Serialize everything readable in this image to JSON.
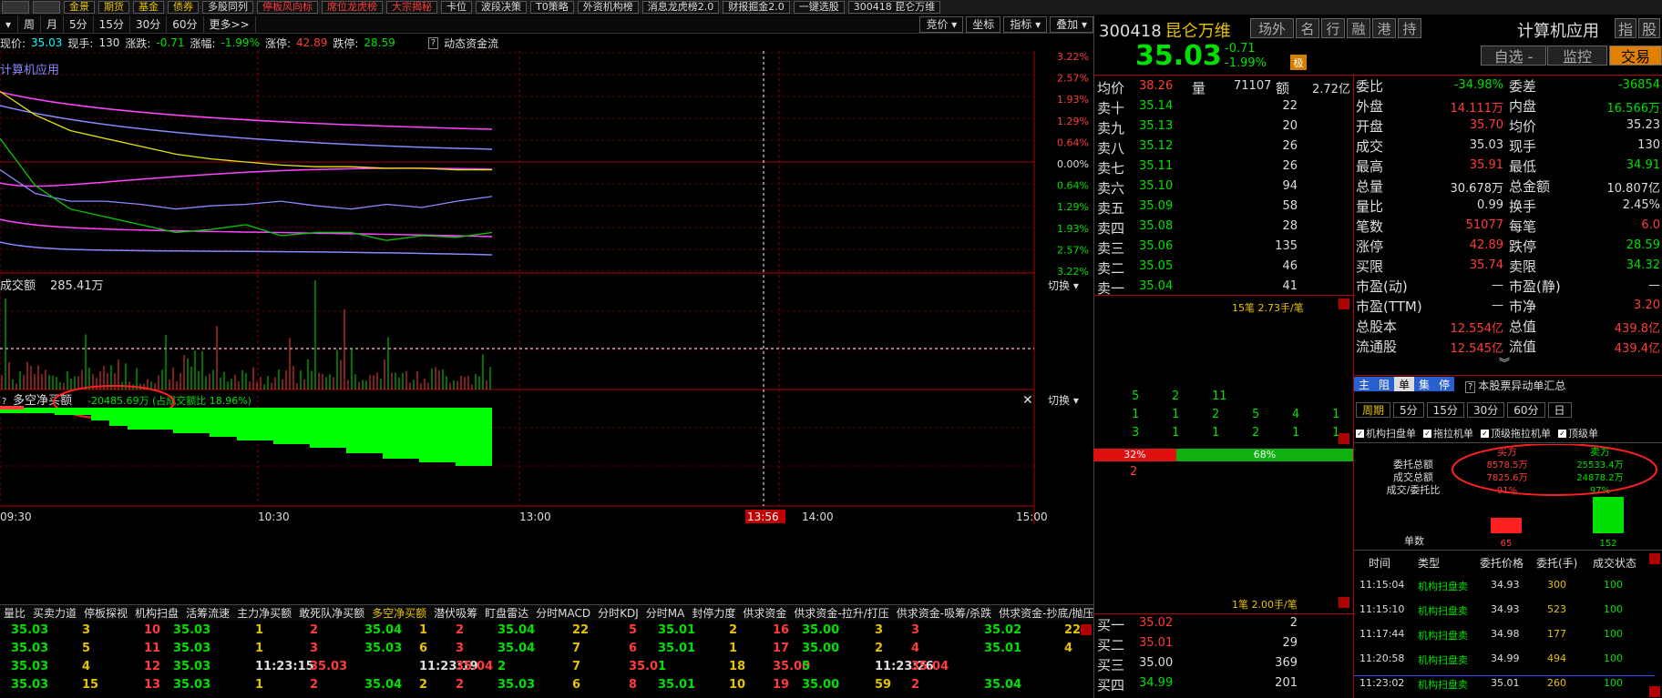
{
  "topbar": {
    "left_items": [
      "金景",
      "期货",
      "基金",
      "债券",
      "多股同列",
      "停板风向标",
      "席位龙虎榜",
      "大宗揭秘",
      "卡位",
      "波段决策",
      "T0策略",
      "外资机构榜",
      "消息龙虎榜2.0",
      "财报掘金2.0",
      "一键选股",
      "300418 昆仑万维"
    ],
    "red_indices": [
      5,
      6,
      7
    ]
  },
  "period_toolbar": {
    "periods": [
      "周",
      "月",
      "5分",
      "15分",
      "30分",
      "60分",
      "更多>>"
    ],
    "right_buttons": [
      "竞价 ▾",
      "坐标",
      "指标 ▾",
      "叠加 ▾"
    ]
  },
  "quote": {
    "price_label": "现价:",
    "price": "35.03",
    "vol_label": "现手:",
    "vol": "130",
    "chg_label": "涨跌:",
    "chg": "-0.71",
    "pct_label": "涨幅:",
    "pct": "-1.99%",
    "up_limit_label": "涨停:",
    "up_limit": "42.89",
    "down_limit_label": "跌停:",
    "down_limit": "28.59",
    "dynamic_flow": "动态资金流",
    "sector": "计算机应用"
  },
  "chart_data": {
    "type": "line",
    "title": "",
    "x_ticks": [
      "09:30",
      "10:30",
      "13:00",
      "13:56",
      "14:00",
      "15:00"
    ],
    "pct_ticks_right": [
      "3.22%",
      "2.57%",
      "1.93%",
      "1.29%",
      "0.64%",
      "0.00%",
      "0.64%",
      "1.29%",
      "1.93%",
      "2.57%",
      "3.22%"
    ],
    "volume_title": "成交额",
    "volume_value": "285.41万",
    "net_title": "多空净买额",
    "net_value": "-20485.69万 (占成交额比 18.96%)",
    "switch_label": "切换 ▾",
    "series": [
      {
        "name": "price",
        "color": "#8888ff",
        "values": [
          35.2,
          35.05,
          35.0,
          35.0,
          34.98,
          34.95,
          34.97,
          34.98,
          35.0,
          34.97,
          34.95,
          34.98,
          34.96,
          35.0,
          35.03
        ]
      },
      {
        "name": "avg",
        "color": "#e6e600",
        "values": [
          35.7,
          35.55,
          35.45,
          35.4,
          35.35,
          35.3,
          35.27,
          35.25,
          35.23,
          35.22,
          35.22,
          35.21,
          35.21,
          35.2,
          35.2
        ]
      },
      {
        "name": "sector",
        "color": "#00cc00",
        "values": [
          35.4,
          35.1,
          34.95,
          34.9,
          34.85,
          34.8,
          34.82,
          34.85,
          34.78,
          34.8,
          34.8,
          34.75,
          34.78,
          34.77,
          34.8
        ]
      }
    ]
  },
  "stock": {
    "code": "300418",
    "name": "昆仑万维",
    "price": "35.03",
    "chg": "-0.71",
    "pct": "-1.99%",
    "tags": [
      "场外",
      "名",
      "行",
      "融",
      "港",
      "持"
    ],
    "sector": "计算机应用",
    "sector_tag": "指",
    "sector_tag2": "股",
    "btn_select": "自选 -",
    "btn_monitor": "监控",
    "btn_trade": "交易",
    "badge": "极"
  },
  "avg_row": {
    "avg_label": "均价",
    "avg": "38.26",
    "vol_label": "量",
    "vol": "71107",
    "amt_label": "额",
    "amt": "2.72亿"
  },
  "asks": [
    {
      "label": "卖十",
      "price": "35.14",
      "qty": "22"
    },
    {
      "label": "卖九",
      "price": "35.13",
      "qty": "20"
    },
    {
      "label": "卖八",
      "price": "35.12",
      "qty": "26"
    },
    {
      "label": "卖七",
      "price": "35.11",
      "qty": "26"
    },
    {
      "label": "卖六",
      "price": "35.10",
      "qty": "94"
    },
    {
      "label": "卖五",
      "price": "35.09",
      "qty": "58"
    },
    {
      "label": "卖四",
      "price": "35.08",
      "qty": "28"
    },
    {
      "label": "卖三",
      "price": "35.06",
      "qty": "135"
    },
    {
      "label": "卖二",
      "price": "35.05",
      "qty": "46"
    },
    {
      "label": "卖一",
      "price": "35.04",
      "qty": "41"
    }
  ],
  "bids": [
    {
      "label": "买一",
      "price": "35.02",
      "qty": "2"
    },
    {
      "label": "买二",
      "price": "35.01",
      "qty": "29"
    },
    {
      "label": "买三",
      "price": "35.00",
      "qty": "369"
    },
    {
      "label": "买四",
      "price": "34.99",
      "qty": "201"
    }
  ],
  "queue": {
    "top": "15笔 2.73手/笔",
    "rows": [
      [
        "5",
        "2",
        "11"
      ],
      [
        "1",
        "1",
        "2",
        "5",
        "4",
        "1"
      ],
      [
        "3",
        "1",
        "1",
        "2",
        "1",
        "1"
      ]
    ],
    "sell_pct": "32%",
    "buy_pct": "68%",
    "first": "2",
    "bottom": "1笔 2.00手/笔"
  },
  "info": [
    {
      "l": "委比",
      "v": "-34.98%",
      "l2": "委差",
      "v2": "-36854"
    },
    {
      "l": "外盘",
      "v": "14.111万",
      "l2": "内盘",
      "v2": "16.566万"
    },
    {
      "l": "开盘",
      "v": "35.70",
      "l2": "均价",
      "v2": "35.23"
    },
    {
      "l": "成交",
      "v": "35.03",
      "l2": "现手",
      "v2": "130"
    },
    {
      "l": "最高",
      "v": "35.91",
      "l2": "最低",
      "v2": "34.91"
    },
    {
      "l": "总量",
      "v": "30.678万",
      "l2": "总金额",
      "v2": "10.807亿"
    },
    {
      "l": "量比",
      "v": "0.99",
      "l2": "换手",
      "v2": "2.45%"
    },
    {
      "l": "笔数",
      "v": "51077",
      "l2": "每笔",
      "v2": "6.0"
    },
    {
      "l": "涨停",
      "v": "42.89",
      "l2": "跌停",
      "v2": "28.59"
    },
    {
      "l": "买限",
      "v": "35.74",
      "l2": "卖限",
      "v2": "34.32"
    },
    {
      "l": "市盈(动)",
      "v": "—",
      "l2": "市盈(静)",
      "v2": "—"
    },
    {
      "l": "市盈(TTM)",
      "v": "—",
      "l2": "市净",
      "v2": "3.20"
    },
    {
      "l": "总股本",
      "v": "12.554亿",
      "l2": "总值",
      "v2": "439.8亿"
    },
    {
      "l": "流通股",
      "v": "12.545亿",
      "l2": "流值",
      "v2": "439.4亿"
    }
  ],
  "fund_tabs": [
    "主",
    "阻",
    "单",
    "集",
    "停"
  ],
  "fund_title": "本股票异动单汇总",
  "fund_period_label": "周期",
  "fund_periods": [
    "5分",
    "15分",
    "30分",
    "60分",
    "日"
  ],
  "fund_checks": [
    "机构扫盘单",
    "拖拉机单",
    "顶级拖拉机单",
    "顶级单"
  ],
  "fund_summary": {
    "buy_head": "买方",
    "sell_head": "卖方",
    "rows": [
      {
        "l": "委托总额",
        "b": "8578.5万",
        "s": "25533.4万"
      },
      {
        "l": "成交总额",
        "b": "7825.6万",
        "s": "24878.2万"
      },
      {
        "l": "成交/委托比",
        "b": "91%",
        "s": "97%"
      }
    ],
    "count_label": "单数",
    "buy_count": "65",
    "sell_count": "152"
  },
  "fund_table": {
    "headers": [
      "时间",
      "类型",
      "委托价格",
      "委托(手)",
      "成交状态"
    ],
    "rows": [
      [
        "11:15:04",
        "机构扫盘卖",
        "34.93",
        "300",
        "100"
      ],
      [
        "11:15:10",
        "机构扫盘卖",
        "34.93",
        "523",
        "100"
      ],
      [
        "11:17:44",
        "机构扫盘卖",
        "34.98",
        "177",
        "100"
      ],
      [
        "11:20:58",
        "机构扫盘卖",
        "34.99",
        "494",
        "100"
      ],
      [
        "11:23:02",
        "机构扫盘卖",
        "35.01",
        "260",
        "100"
      ]
    ]
  },
  "bottom_tabs": [
    "量比",
    "买卖力道",
    "停板探视",
    "机构扫盘",
    "活筹流速",
    "主力净买额",
    "敢死队净买额",
    "多空净买额",
    "潜伏吸筹",
    "盯盘雷达",
    "分时MACD",
    "分时KDJ",
    "分时MA",
    "封停力度",
    "供求资金",
    "供求资金-拉升/打压",
    "供求资金-吸筹/杀跌",
    "供求资金-抄底/抛压"
  ],
  "bottom_active": 7,
  "bottom_rows": [
    [
      "35.03",
      "3",
      "10",
      "35.03",
      "1",
      "2",
      "35.04",
      "1",
      "2",
      "35.04",
      "22",
      "5",
      "35.01",
      "2",
      "16",
      "35.00",
      "3",
      "3",
      "35.02",
      "22"
    ],
    [
      "35.03",
      "5",
      "11",
      "35.03",
      "1",
      "3",
      "35.03",
      "6",
      "3",
      "35.04",
      "7",
      "6",
      "35.01",
      "1",
      "17",
      "35.00",
      "2",
      "4",
      "35.01",
      "4"
    ],
    [
      "35.03",
      "4",
      "12",
      "35.03",
      "11:23:15",
      "35.03",
      "",
      "11:23:19",
      "35.04",
      "2",
      "7",
      "35.01",
      "1",
      "18",
      "35.00",
      "5",
      "11:23:26",
      "35.04",
      "",
      ""
    ],
    [
      "35.03",
      "15",
      "13",
      "35.03",
      "1",
      "2",
      "35.04",
      "2",
      "2",
      "35.03",
      "6",
      "8",
      "35.01",
      "10",
      "19",
      "35.00",
      "59",
      "2",
      "35.04",
      ""
    ]
  ]
}
